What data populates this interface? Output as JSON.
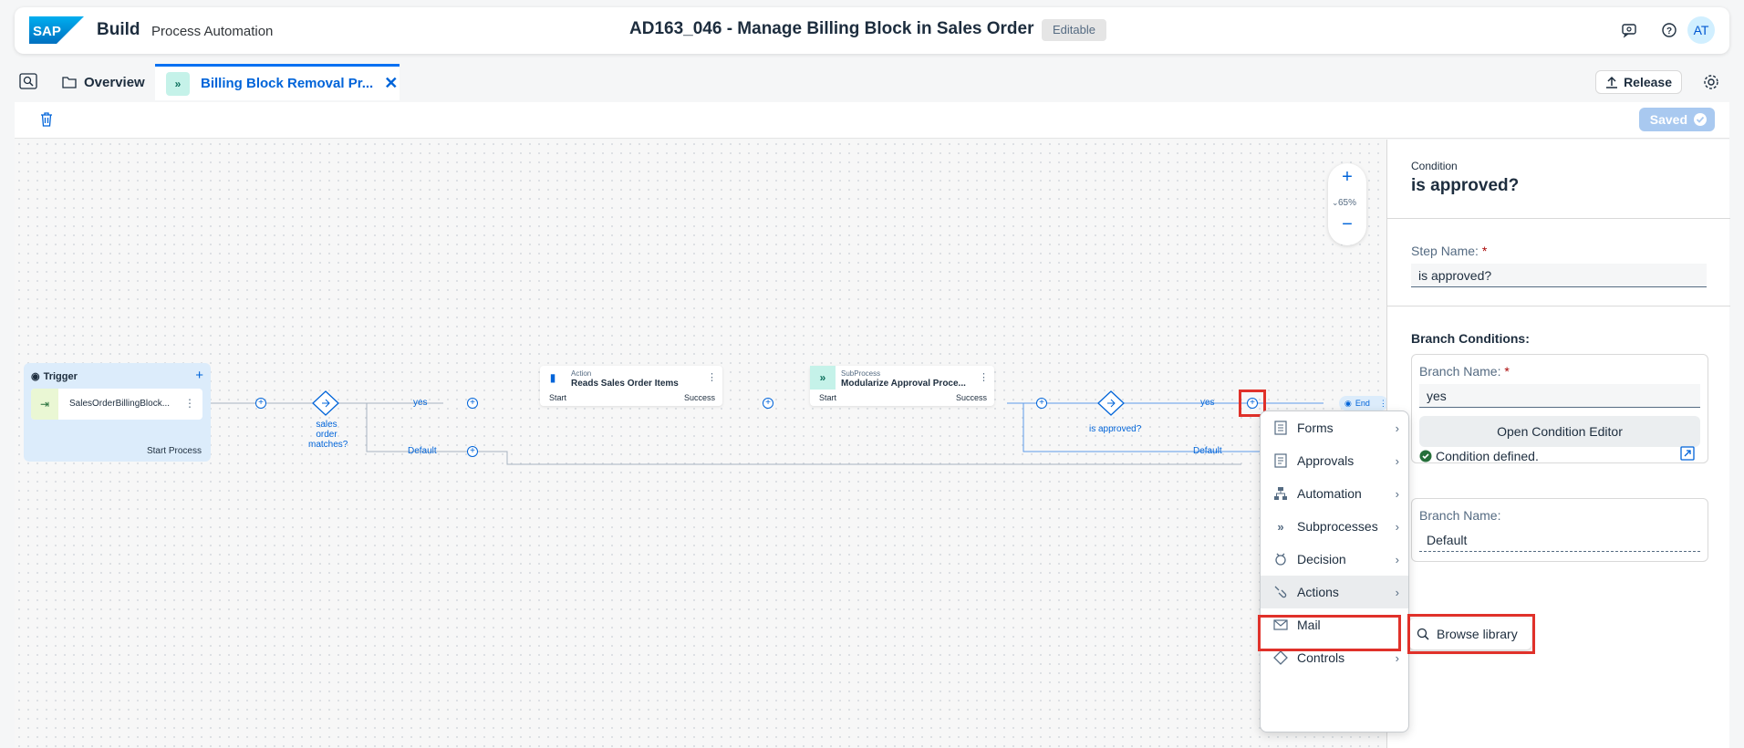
{
  "shell": {
    "logo_text": "SAP",
    "app_name": "Build",
    "app_subtitle": "Process Automation",
    "document_title": "AD163_046 - Manage Billing Block in Sales Order",
    "status_badge": "Editable",
    "avatar_initials": "AT"
  },
  "tabs": {
    "overview_label": "Overview",
    "active_label": "Billing Block Removal Pr...",
    "release_label": "Release"
  },
  "toolbar": {
    "saved_label": "Saved"
  },
  "canvas": {
    "zoom_level": "65%",
    "trigger": {
      "title": "Trigger",
      "item": "SalesOrderBillingBlock...",
      "footer": "Start Process"
    },
    "decision1_label": "sales order matches?",
    "decision2_label": "is approved?",
    "branch_yes_1": "yes",
    "branch_yes_2": "yes",
    "branch_default_1": "Default",
    "branch_default_2": "Default",
    "action1": {
      "type": "Action",
      "name": "Reads Sales Order Items",
      "start": "Start",
      "success": "Success"
    },
    "action2": {
      "type": "SubProcess",
      "name": "Modularize Approval Proce...",
      "start": "Start",
      "success": "Success"
    },
    "end_label": "End"
  },
  "menu": {
    "items": [
      {
        "label": "Forms",
        "icon": "form-icon"
      },
      {
        "label": "Approvals",
        "icon": "approval-icon"
      },
      {
        "label": "Automation",
        "icon": "automation-icon"
      },
      {
        "label": "Subprocesses",
        "icon": "subprocess-icon"
      },
      {
        "label": "Decision",
        "icon": "decision-icon"
      },
      {
        "label": "Actions",
        "icon": "actions-icon"
      },
      {
        "label": "Mail",
        "icon": "mail-icon"
      },
      {
        "label": "Controls",
        "icon": "controls-icon"
      }
    ],
    "submenu_label": "Browse library"
  },
  "panel": {
    "kind": "Condition",
    "title": "is approved?",
    "step_name_label": "Step Name:",
    "step_name_value": "is approved?",
    "branch_conditions_label": "Branch Conditions:",
    "branch1": {
      "name_label": "Branch Name:",
      "name_value": "yes",
      "button_label": "Open Condition Editor",
      "status": "Condition defined."
    },
    "branch2": {
      "name_label": "Branch Name:",
      "name_value": "Default"
    }
  },
  "colors": {
    "accent": "#0064d9",
    "highlight_box": "#e0312a",
    "success": "#256f3a"
  }
}
